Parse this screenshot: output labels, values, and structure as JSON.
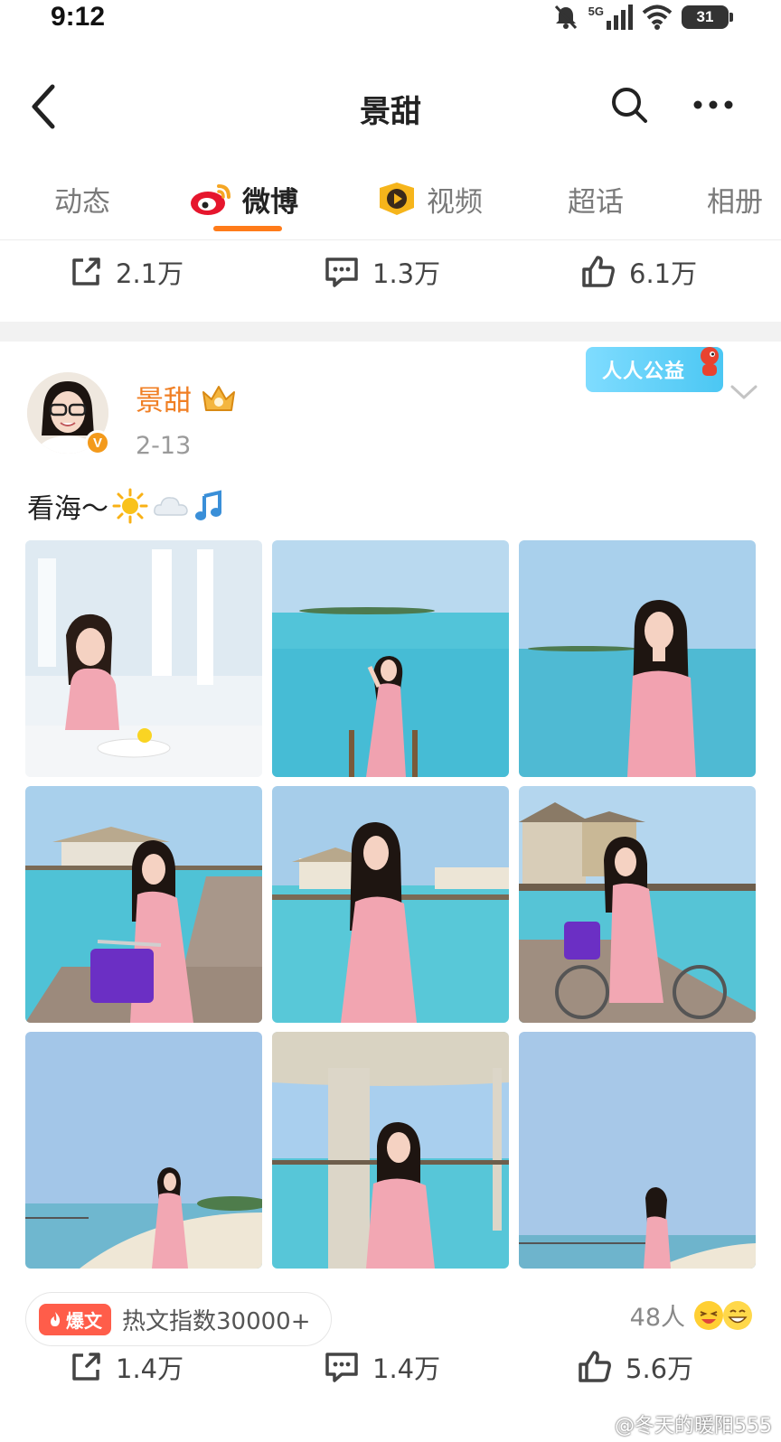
{
  "status_bar": {
    "time": "9:12",
    "network": "5G",
    "battery": "31"
  },
  "header": {
    "title": "景甜"
  },
  "tabs": [
    {
      "label": "动态"
    },
    {
      "label": "微博"
    },
    {
      "label": "视频"
    },
    {
      "label": "超话"
    },
    {
      "label": "相册"
    }
  ],
  "prev_post_actions": {
    "repost": "2.1万",
    "comment": "1.3万",
    "like": "6.1万"
  },
  "post": {
    "author": "景甜",
    "verified_badge": "V",
    "date": "2-13",
    "text": "看海～",
    "text_emojis": [
      "sun-emoji",
      "cloud-emoji",
      "music-note-emoji"
    ],
    "charity_badge": "人人公益",
    "photos": [
      {
        "scene": "cafe-table"
      },
      {
        "scene": "sea-standing"
      },
      {
        "scene": "sea-closeup"
      },
      {
        "scene": "pier-bicycle"
      },
      {
        "scene": "pier-standing"
      },
      {
        "scene": "pier-bicycle-hut"
      },
      {
        "scene": "beach-walk"
      },
      {
        "scene": "pillar-pose"
      },
      {
        "scene": "beach-back"
      }
    ],
    "hot_badge": "爆文",
    "hot_text": "热文指数30000+",
    "reaction_count": "48人",
    "actions": {
      "repost": "1.4万",
      "comment": "1.4万",
      "like": "5.6万"
    }
  },
  "watermark": "@冬天的暖阳555",
  "colors": {
    "accent": "#ff7b1a",
    "username": "#f07f24",
    "hot": "#ff5d4a",
    "sea": "#4cc3d8",
    "sky": "#9ec9ec",
    "dress": "#f2a7b3"
  }
}
